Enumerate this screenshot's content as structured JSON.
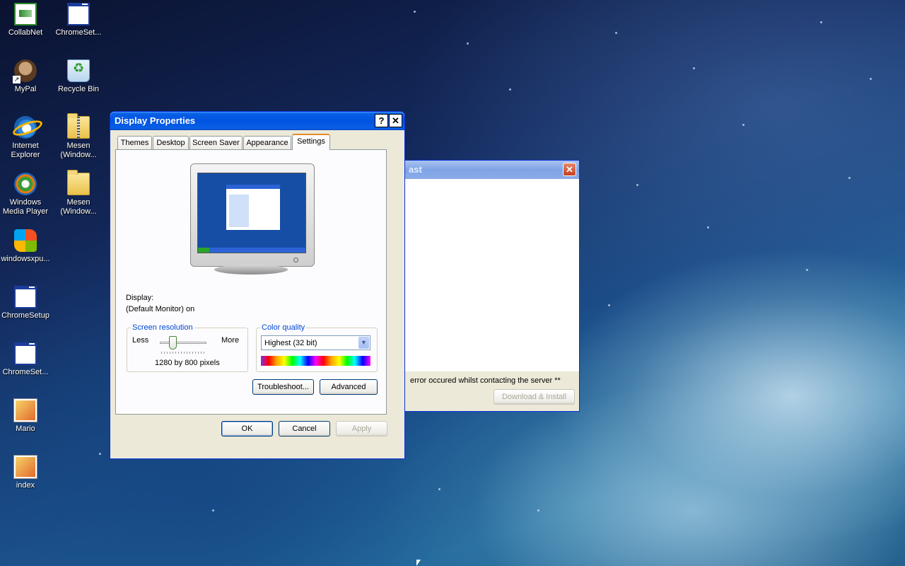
{
  "desktop_icons": [
    {
      "label": "CollabNet",
      "icon": "collabnet-icon"
    },
    {
      "label": "ChromeSet...",
      "icon": "window-app-icon"
    },
    {
      "label": "MyPal",
      "icon": "mypal-shortcut-icon"
    },
    {
      "label": "Recycle Bin",
      "icon": "recycle-bin-icon"
    },
    {
      "label": "Internet Explorer",
      "icon": "internet-explorer-icon"
    },
    {
      "label": "Mesen (Window...",
      "icon": "zip-folder-icon"
    },
    {
      "label": "Windows Media Player",
      "icon": "media-player-icon"
    },
    {
      "label": "Mesen (Window...",
      "icon": "folder-icon"
    },
    {
      "label": "windowsxpu...",
      "icon": "windows-logo-icon"
    },
    {
      "label": "ChromeSetup",
      "icon": "window-app-icon"
    },
    {
      "label": "ChromeSet...",
      "icon": "window-app-icon"
    },
    {
      "label": "Mario",
      "icon": "image-file-icon"
    },
    {
      "label": "index",
      "icon": "image-file-icon"
    }
  ],
  "display_properties": {
    "title": "Display Properties",
    "help_button": "?",
    "close_button": "✕",
    "tabs": [
      "Themes",
      "Desktop",
      "Screen Saver",
      "Appearance",
      "Settings"
    ],
    "active_tab": "Settings",
    "display_label": "Display:",
    "display_value": "(Default Monitor) on",
    "screen_resolution": {
      "legend": "Screen resolution",
      "less": "Less",
      "more": "More",
      "value": "1280 by 800 pixels"
    },
    "color_quality": {
      "legend": "Color quality",
      "selected": "Highest (32 bit)"
    },
    "troubleshoot_button": "Troubleshoot...",
    "advanced_button": "Advanced",
    "ok_button": "OK",
    "cancel_button": "Cancel",
    "apply_button": "Apply"
  },
  "background_window": {
    "title_fragment": "ast",
    "close_button": "✕",
    "error_text": "error occured whilst contacting the server **",
    "download_button": "Download & Install"
  },
  "colors": {
    "titlebar_blue": "#0053e1",
    "dialog_face": "#ece9d8",
    "tab_highlight": "#e68b2c",
    "legend_blue": "#0046d5"
  }
}
